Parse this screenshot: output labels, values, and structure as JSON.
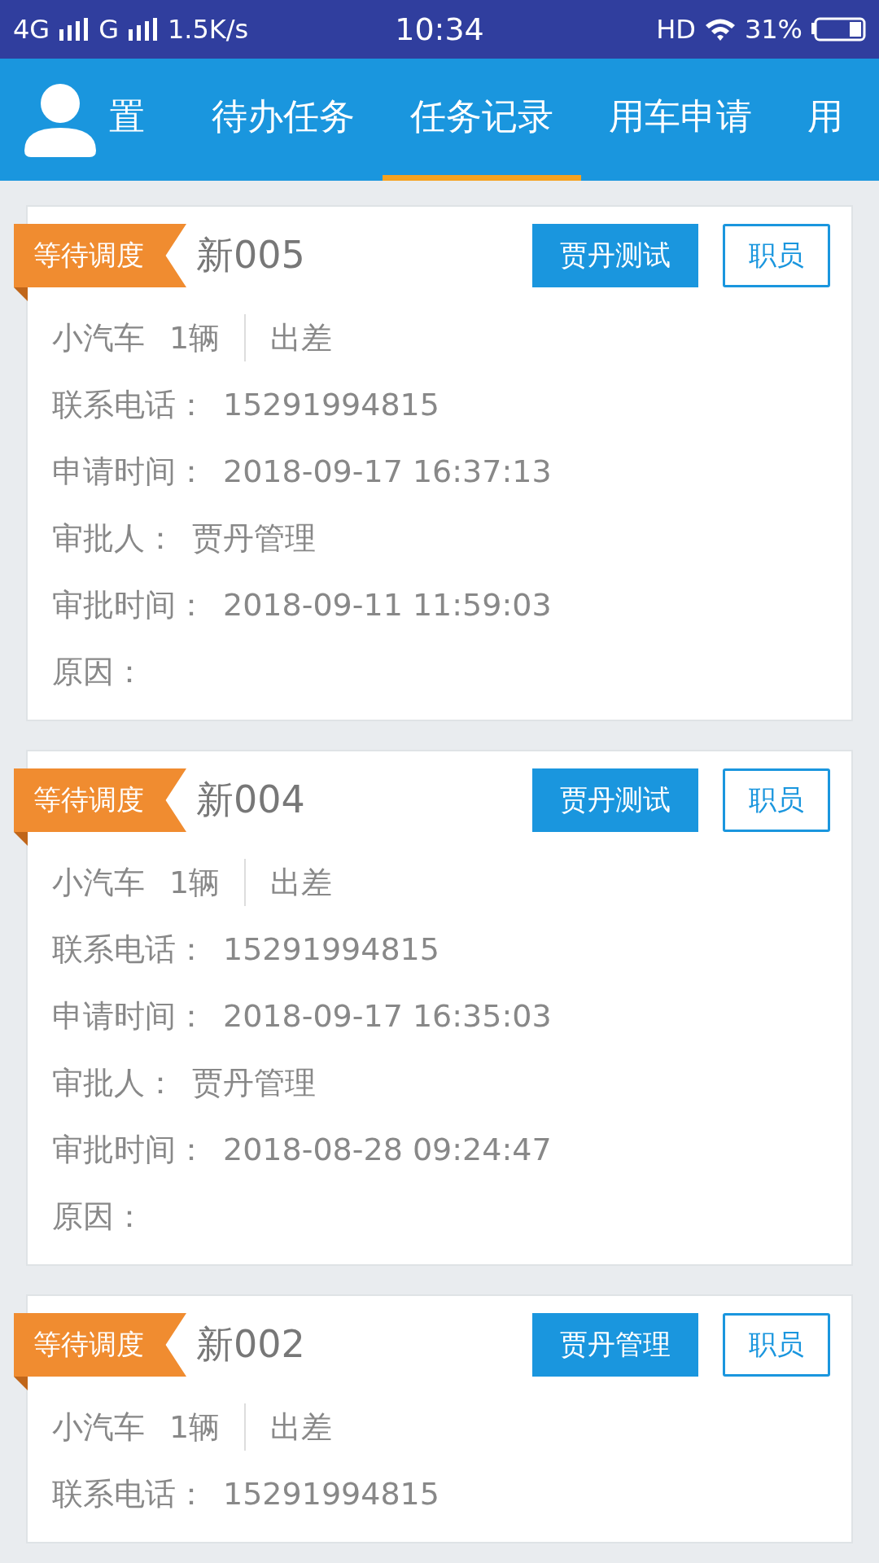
{
  "status_bar": {
    "network_1": "4G",
    "network_2": "G",
    "speed": "1.5K/s",
    "time": "10:34",
    "hd": "HD",
    "battery": "31%"
  },
  "tabs": [
    {
      "label": "置",
      "selected": false
    },
    {
      "label": "待办任务",
      "selected": false
    },
    {
      "label": "任务记录",
      "selected": true
    },
    {
      "label": "用车申请",
      "selected": false
    },
    {
      "label": "用",
      "selected": false
    }
  ],
  "records": [
    {
      "status": "等待调度",
      "title": "新005",
      "assignee": "贾丹测试",
      "role": "职员",
      "vehicle": "小汽车",
      "count": "1辆",
      "purpose": "出差",
      "fields": [
        {
          "label": "联系电话：",
          "value": "15291994815"
        },
        {
          "label": "申请时间：",
          "value": "2018-09-17 16:37:13"
        },
        {
          "label": "审批人：",
          "value": "贾丹管理"
        },
        {
          "label": "审批时间：",
          "value": "2018-09-11 11:59:03"
        },
        {
          "label": "原因："
        }
      ]
    },
    {
      "status": "等待调度",
      "title": "新004",
      "assignee": "贾丹测试",
      "role": "职员",
      "vehicle": "小汽车",
      "count": "1辆",
      "purpose": "出差",
      "fields": [
        {
          "label": "联系电话：",
          "value": "15291994815"
        },
        {
          "label": "申请时间：",
          "value": "2018-09-17 16:35:03"
        },
        {
          "label": "审批人：",
          "value": "贾丹管理"
        },
        {
          "label": "审批时间：",
          "value": "2018-08-28 09:24:47"
        },
        {
          "label": "原因："
        }
      ]
    },
    {
      "status": "等待调度",
      "title": "新002",
      "assignee": "贾丹管理",
      "role": "职员",
      "vehicle": "小汽车",
      "count": "1辆",
      "purpose": "出差",
      "fields": [
        {
          "label": "联系电话：",
          "value": "15291994815"
        }
      ]
    }
  ]
}
